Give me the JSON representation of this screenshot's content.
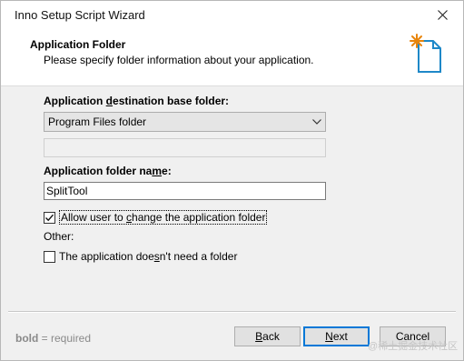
{
  "window": {
    "title": "Inno Setup Script Wizard"
  },
  "header": {
    "title": "Application Folder",
    "subtitle": "Please specify folder information about your application.",
    "icon": "wizard-page-icon"
  },
  "form": {
    "dest_label_pre": "Application ",
    "dest_label_key": "d",
    "dest_label_post": "estination base folder:",
    "dest_value": "Program Files folder",
    "custom_path_value": "",
    "name_label_pre": "Application folder na",
    "name_label_key": "m",
    "name_label_post": "e:",
    "name_value": "SplitTool",
    "allow_change_checked": true,
    "allow_change_pre": "Allow user to ",
    "allow_change_key": "c",
    "allow_change_post": "hange the application folder",
    "other_label": "Other:",
    "no_folder_checked": false,
    "no_folder_pre": "The application doe",
    "no_folder_key": "s",
    "no_folder_post": "n't need a folder"
  },
  "footer": {
    "hint_bold": "bold",
    "hint_rest": " = required",
    "back_key": "B",
    "back_rest": "ack",
    "next_key": "N",
    "next_rest": "ext",
    "cancel_label": "Cancel"
  },
  "watermark": "@稀土掘金技术社区",
  "colors": {
    "accent": "#0078d7",
    "icon_star": "#e8850c",
    "icon_page": "#1e88c8"
  }
}
